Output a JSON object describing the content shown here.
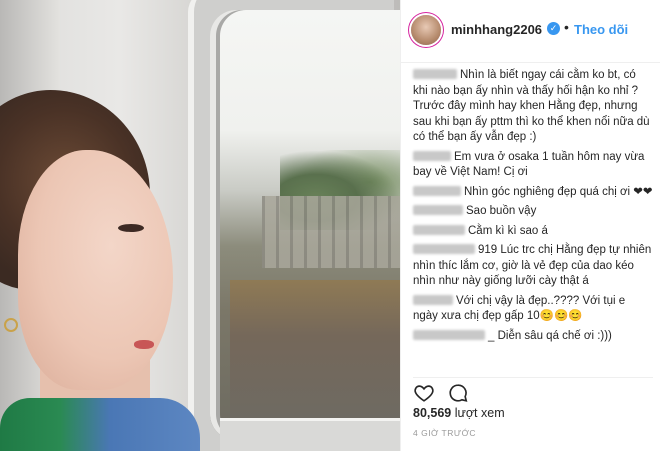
{
  "header": {
    "username": "minhhang2206",
    "verified_glyph": "✓",
    "separator": "•",
    "follow_label": "Theo dõi"
  },
  "comments": [
    {
      "text": "Nhìn là biết ngay cái cằm ko bt, có khi nào bạn ấy nhìn và thấy hối hận ko nhỉ ? Trước đây mình hay khen Hằng đẹp, nhưng sau khi bạn ấy pttm thì ko thể khen nổi nữa dù có thể bạn ấy vẫn đẹp :)"
    },
    {
      "text": "Em vưa ở osaka 1 tuần hôm nay vừa bay về Việt Nam! Cị ơi"
    },
    {
      "text": "Nhìn góc nghiêng đẹp quá chị ơi ❤❤"
    },
    {
      "text": "Sao buồn vậy"
    },
    {
      "text": "Cằm kì kì sao á"
    },
    {
      "text": "919 Lúc trc chị Hằng đẹp tự nhiên nhìn thíc lắm cơ, giờ là vẻ đẹp của dao kéo nhìn như này giống lưỡi cày thật á"
    },
    {
      "text": "Với chị vậy là đẹp..???? Với tụi e ngày xưa chị đẹp gấp 10😊😊😊"
    },
    {
      "text": "_ Diễn sâu qá chế ơi :)))"
    }
  ],
  "actions": {
    "like_icon": "heart-outline-icon",
    "comment_icon": "speech-bubble-icon"
  },
  "stats": {
    "views_count": "80,569",
    "views_label": "lượt xem",
    "timestamp": "4 GIỜ TRƯỚC"
  },
  "colors": {
    "accent": "#3897f0",
    "text": "#262626",
    "muted": "#999999"
  }
}
